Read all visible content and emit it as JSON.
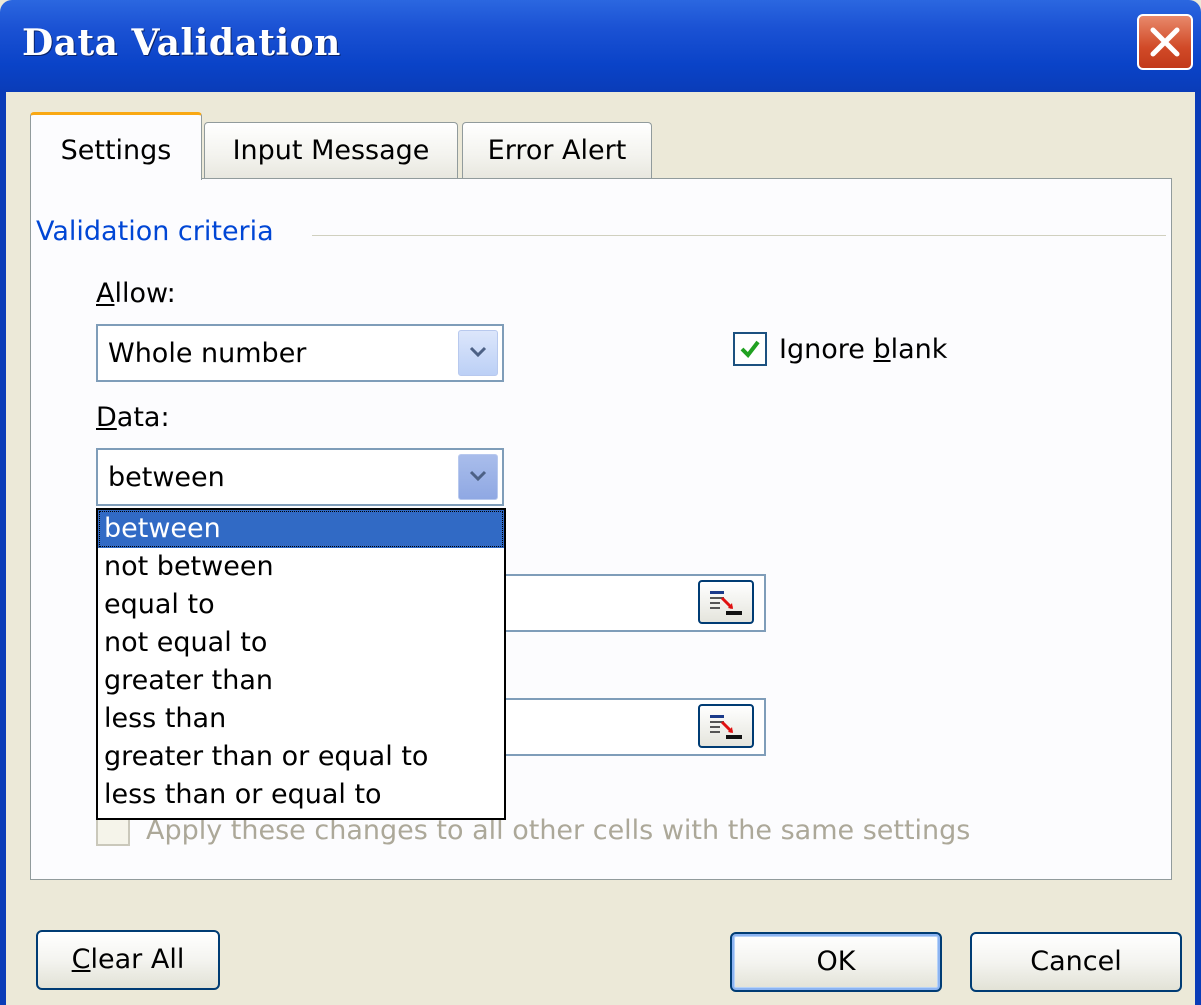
{
  "window": {
    "title": "Data Validation"
  },
  "tabs": [
    {
      "label": "Settings",
      "active": true
    },
    {
      "label": "Input Message",
      "active": false
    },
    {
      "label": "Error Alert",
      "active": false
    }
  ],
  "settings": {
    "group_title": "Validation criteria",
    "allow_label_key": "A",
    "allow_label_rest": "llow:",
    "allow_value": "Whole number",
    "data_label_key": "D",
    "data_label_rest": "ata:",
    "data_value": "between",
    "ignore_blank_pre": "Ignore ",
    "ignore_blank_key": "b",
    "ignore_blank_post": "lank",
    "ignore_blank_checked": true,
    "apply_label": "Apply these changes to all other cells with the same settings",
    "apply_checked": false
  },
  "dropdown": {
    "options": [
      "between",
      "not between",
      "equal to",
      "not equal to",
      "greater than",
      "less than",
      "greater than or equal to",
      "less than or equal to"
    ],
    "selected": "between"
  },
  "buttons": {
    "clear_all_key": "C",
    "clear_all_rest": "lear All",
    "ok": "OK",
    "cancel": "Cancel"
  },
  "colors": {
    "titlebar": "#0A43C8",
    "group_label": "#0046D5",
    "selection": "#316AC5",
    "active_tab_accent": "#F9A813"
  }
}
